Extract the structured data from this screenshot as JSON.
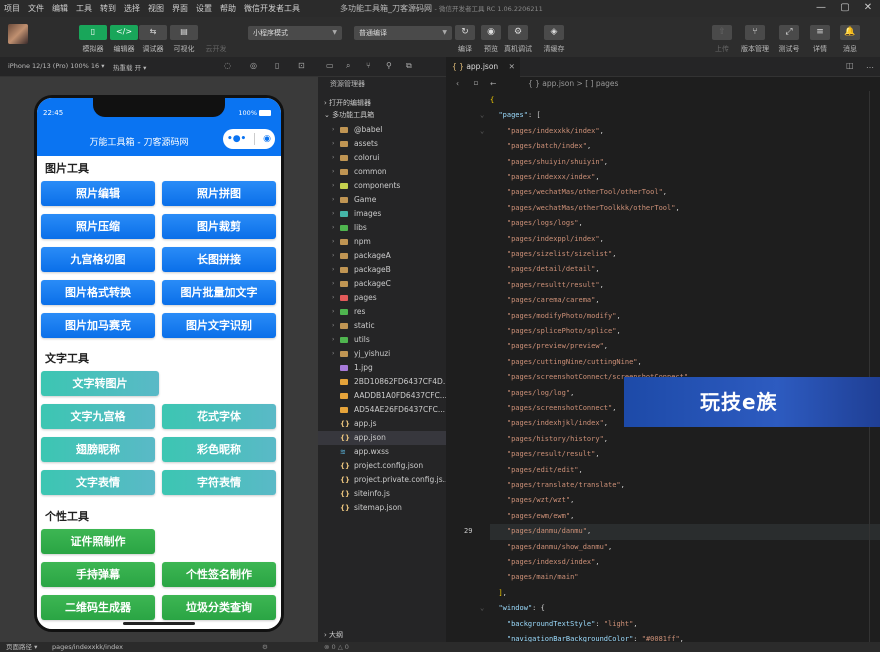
{
  "menu": [
    "项目",
    "文件",
    "编辑",
    "工具",
    "转到",
    "选择",
    "视图",
    "界面",
    "设置",
    "帮助",
    "微信开发者工具"
  ],
  "window_title": "多功能工具箱_刀客源码网",
  "window_version": "- 微信开发者工具 RC 1.06.2206211",
  "window_controls": [
    "—",
    "▢",
    "✕"
  ],
  "toolbar": {
    "buttons": [
      {
        "icon": "▯",
        "label": "模拟器",
        "active": true
      },
      {
        "icon": "</>",
        "label": "编辑器",
        "active": true
      },
      {
        "icon": "⇆",
        "label": "调试器",
        "active": false
      },
      {
        "icon": "▤",
        "label": "可视化",
        "active": false
      },
      {
        "icon": "",
        "label": "云开发",
        "active": false
      }
    ],
    "mode_select": "小程序模式",
    "compile_select": "普通编译",
    "actions": [
      {
        "icon": "↻",
        "label": "编译"
      },
      {
        "icon": "◉",
        "label": "预览"
      },
      {
        "icon": "⚙",
        "label": "真机调试"
      },
      {
        "icon": "◈",
        "label": "清缓存"
      }
    ],
    "right_actions": [
      {
        "icon": "⇧",
        "label": "上传"
      },
      {
        "icon": "⑂",
        "label": "版本管理"
      },
      {
        "icon": "⤢",
        "label": "测试号"
      },
      {
        "icon": "≡",
        "label": "详情"
      },
      {
        "icon": "🔔",
        "label": "消息"
      }
    ]
  },
  "device": {
    "name": "iPhone 12/13 (Pro) 100% 16 ▾",
    "hotreload": "热重载 开 ▾"
  },
  "phone": {
    "time": "22:45",
    "battery": "100%",
    "title": "万能工具箱 - 刀客源码网",
    "sections": [
      {
        "title": "图片工具",
        "buttons": [
          "照片编辑",
          "照片拼图",
          "照片压缩",
          "图片裁剪",
          "九宫格切图",
          "长图拼接",
          "图片格式转换",
          "图片批量加文字",
          "图片加马赛克",
          "图片文字识别"
        ]
      },
      {
        "title": "文字工具",
        "buttons": [
          "文字转图片",
          "文字九宫格",
          "花式字体",
          "翅膀昵称",
          "彩色昵称",
          "文字表情",
          "字符表情"
        ]
      },
      {
        "title": "个性工具",
        "buttons": [
          "证件照制作",
          "手持弹幕",
          "个性签名制作",
          "二维码生成器",
          "垃圾分类查询"
        ]
      }
    ]
  },
  "explorer": {
    "title": "资源管理器",
    "open_editors": "打开的编辑器",
    "project": "多功能工具箱",
    "items": [
      {
        "name": "@babel",
        "type": "folder",
        "color": "#c09553"
      },
      {
        "name": "assets",
        "type": "folder",
        "color": "#c09553"
      },
      {
        "name": "colorui",
        "type": "folder",
        "color": "#c09553"
      },
      {
        "name": "common",
        "type": "folder",
        "color": "#c09553"
      },
      {
        "name": "components",
        "type": "folder",
        "color": "#c5d14e"
      },
      {
        "name": "Game",
        "type": "folder",
        "color": "#c09553"
      },
      {
        "name": "images",
        "type": "folder",
        "color": "#45b5a8"
      },
      {
        "name": "libs",
        "type": "folder",
        "color": "#4fb54f"
      },
      {
        "name": "npm",
        "type": "folder",
        "color": "#c09553"
      },
      {
        "name": "packageA",
        "type": "folder",
        "color": "#c09553"
      },
      {
        "name": "packageB",
        "type": "folder",
        "color": "#c09553"
      },
      {
        "name": "packageC",
        "type": "folder",
        "color": "#c09553"
      },
      {
        "name": "pages",
        "type": "folder",
        "color": "#e35a5a"
      },
      {
        "name": "res",
        "type": "folder",
        "color": "#4fb54f"
      },
      {
        "name": "static",
        "type": "folder",
        "color": "#c09553"
      },
      {
        "name": "utils",
        "type": "folder",
        "color": "#4fb54f"
      },
      {
        "name": "yj_yishuzi",
        "type": "folder",
        "color": "#c09553"
      },
      {
        "name": "1.jpg",
        "type": "image",
        "color": "#a77ad9"
      },
      {
        "name": "2BD10862FD6437CF4D...",
        "type": "image",
        "color": "#e5a33a"
      },
      {
        "name": "AADDB1A0FD6437CFC...",
        "type": "image",
        "color": "#e5a33a"
      },
      {
        "name": "AD54AE26FD6437CFC...",
        "type": "image",
        "color": "#e5a33a"
      },
      {
        "name": "app.js",
        "type": "js",
        "color": "#e5c07b"
      },
      {
        "name": "app.json",
        "type": "json",
        "color": "#e5c07b"
      },
      {
        "name": "app.wxss",
        "type": "wxss",
        "color": "#519aba"
      },
      {
        "name": "project.config.json",
        "type": "json",
        "color": "#e5c07b"
      },
      {
        "name": "project.private.config.js...",
        "type": "json",
        "color": "#e5c07b"
      },
      {
        "name": "siteinfo.js",
        "type": "js",
        "color": "#e5c07b"
      },
      {
        "name": "sitemap.json",
        "type": "json",
        "color": "#e5c07b"
      }
    ],
    "outline": "大纲"
  },
  "editor": {
    "tab": "app.json",
    "breadcrumb": "{ } app.json > [ ] pages",
    "active_line": "29",
    "lines": [
      "{",
      "  \"pages\": [",
      "    \"pages/indexxkk/index\",",
      "    \"pages/batch/index\",",
      "    \"pages/shuiyin/shuiyin\",",
      "    \"pages/indexxx/index\",",
      "    \"pages/wechatMas/otherTool/otherTool\",",
      "    \"pages/wechatMas/otherToolkkk/otherTool\",",
      "    \"pages/logs/logs\",",
      "    \"pages/indexppl/index\",",
      "    \"pages/sizelist/sizelist\",",
      "    \"pages/detail/detail\",",
      "    \"pages/resultt/result\",",
      "    \"pages/carema/carema\",",
      "    \"pages/modifyPhoto/modify\",",
      "    \"pages/splicePhoto/splice\",",
      "    \"pages/preview/preview\",",
      "    \"pages/cuttingNine/cuttingNine\",",
      "    \"pages/screenshotConnect/screenshotConnect\",",
      "    \"pages/log/log\",",
      "    \"pages/screenshotConnect\",",
      "    \"pages/indexhjkl/index\",",
      "    \"pages/history/history\",",
      "    \"pages/result/result\",",
      "    \"pages/edit/edit\",",
      "    \"pages/translate/translate\",",
      "    \"pages/wzt/wzt\",",
      "    \"pages/ewm/ewm\",",
      "    \"pages/danmu/danmu\",",
      "    \"pages/danmu/show_danmu\",",
      "    \"pages/indexsd/index\",",
      "    \"pages/main/main\"",
      "  ],",
      "  \"window\": {",
      "    \"backgroundTextStyle\": \"light\",",
      "    \"navigationBarBackgroundColor\": \"#0081ff\","
    ]
  },
  "watermark": "玩技e族",
  "status": {
    "left": "页面路径 ▾",
    "path": "pages/indexxkk/index"
  }
}
